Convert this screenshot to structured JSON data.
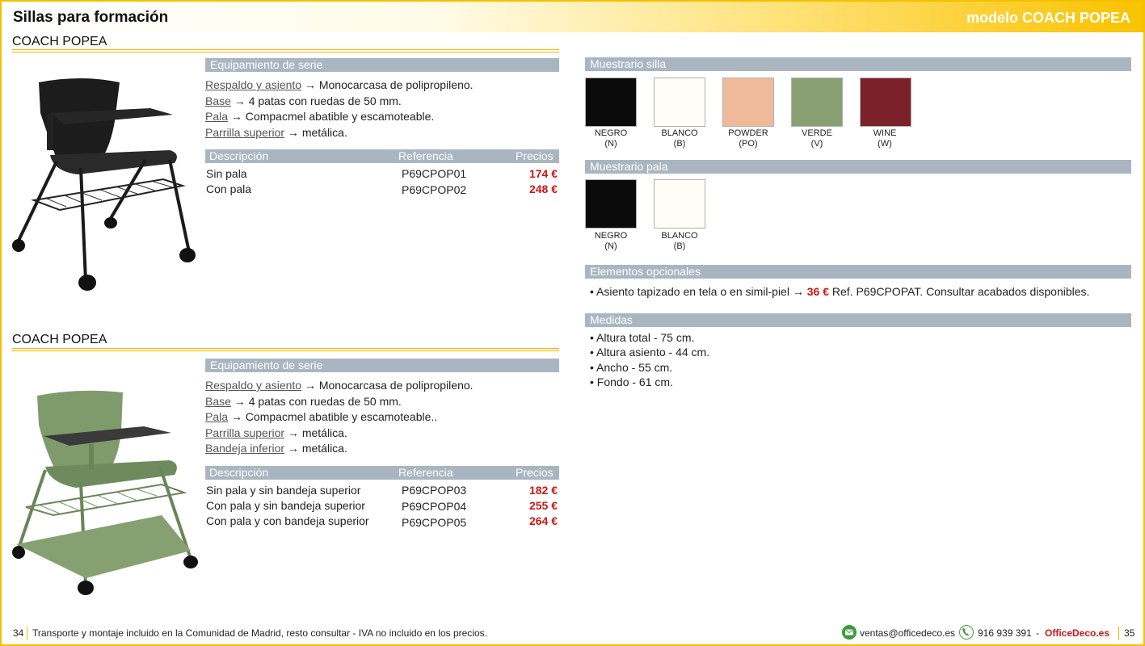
{
  "header": {
    "title": "Sillas para formación",
    "model": "modelo COACH POPEA"
  },
  "products": [
    {
      "name": "COACH POPEA",
      "equip_title": "Equipamiento de serie",
      "features": [
        {
          "label": "Respaldo y asiento",
          "text": " → Monocarcasa de polipropileno."
        },
        {
          "label": "Base",
          "text": " → 4 patas con ruedas de 50 mm."
        },
        {
          "label": "Pala",
          "text": " → Compacmel abatible y escamoteable."
        },
        {
          "label": "Parrilla superior",
          "text": " → metálica."
        }
      ],
      "table_headers": {
        "desc": "Descripción",
        "ref": "Referencia",
        "price": "Precios"
      },
      "rows": [
        {
          "desc": "Sin pala",
          "ref": "P69CPOP01",
          "price": "174 €"
        },
        {
          "desc": "Con pala",
          "ref": "P69CPOP02",
          "price": "248 €"
        }
      ]
    },
    {
      "name": "COACH POPEA",
      "equip_title": "Equipamiento de serie",
      "features": [
        {
          "label": "Respaldo y asiento",
          "text": " → Monocarcasa de polipropileno."
        },
        {
          "label": "Base",
          "text": " → 4 patas con ruedas de 50 mm."
        },
        {
          "label": "Pala",
          "text": " → Compacmel abatible y escamoteable.."
        },
        {
          "label": "Parrilla superior",
          "text": " → metálica."
        },
        {
          "label": "Bandeja inferior",
          "text": " → metálica."
        }
      ],
      "table_headers": {
        "desc": "Descripción",
        "ref": "Referencia",
        "price": "Precios"
      },
      "rows": [
        {
          "desc": "Sin pala y sin bandeja superior",
          "ref": "P69CPOP03",
          "price": "182 €"
        },
        {
          "desc": "Con pala y sin bandeja superior",
          "ref": "P69CPOP04",
          "price": "255 €"
        },
        {
          "desc": "Con pala y con bandeja superior",
          "ref": "P69CPOP05",
          "price": "264 €"
        }
      ]
    }
  ],
  "muestrario_silla": {
    "title": "Muestrario silla",
    "swatches": [
      {
        "name": "NEGRO",
        "code": "(N)",
        "color": "#0b0b0c"
      },
      {
        "name": "BLANCO",
        "code": "(B)",
        "color": "#fdfdf6"
      },
      {
        "name": "POWDER",
        "code": "(PO)",
        "color": "#efba9a"
      },
      {
        "name": "VERDE",
        "code": "(V)",
        "color": "#88a073"
      },
      {
        "name": "WINE",
        "code": "(W)",
        "color": "#7a2129"
      }
    ]
  },
  "muestrario_pala": {
    "title": "Muestrario pala",
    "swatches": [
      {
        "name": "NEGRO",
        "code": "(N)",
        "color": "#0b0b0c"
      },
      {
        "name": "BLANCO",
        "code": "(B)",
        "color": "#fdfdf6"
      }
    ]
  },
  "opcionales": {
    "title": "Elementos opcionales",
    "item_before": "Asiento tapizado en tela o en simil-piel →",
    "item_price": "36 €",
    "item_after": "Ref. P69CPOPAT. Consultar acabados disponibles."
  },
  "medidas": {
    "title": "Medidas",
    "items": [
      "Altura total - 75 cm.",
      "Altura asiento - 44 cm.",
      "Ancho - 55 cm.",
      "Fondo - 61 cm."
    ]
  },
  "footer": {
    "page_left": "34",
    "note": "Transporte y montaje incluido en la Comunidad de Madrid, resto consultar - IVA no incluido en los precios.",
    "email": "ventas@officedeco.es",
    "phone": "916 939 391",
    "dash": "-",
    "brand": "OfficeDeco.es",
    "page_right": "35"
  },
  "colors": {
    "accent": "#f2b700",
    "price": "#cc1616",
    "bar": "#a9b6c1"
  },
  "icons": [
    "email-icon",
    "phone-icon"
  ]
}
